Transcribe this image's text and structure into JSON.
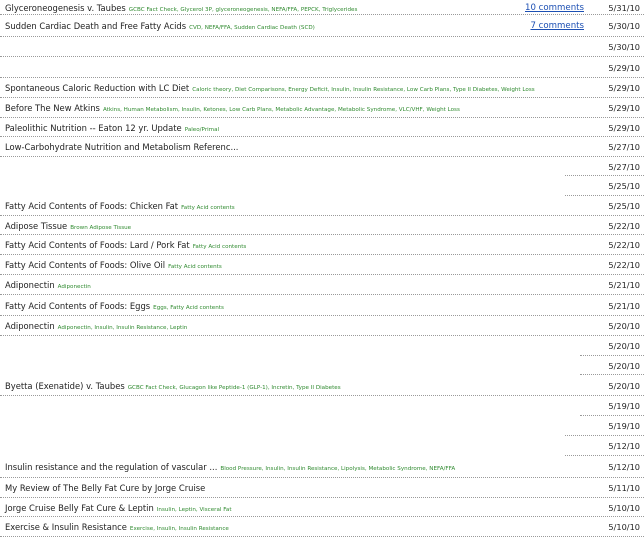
{
  "posts": [
    {
      "title": "Glyceroneogenesis v. Taubes",
      "tags": "GCBC Fact Check, Glycerol 3P, glyceroneogenesis, NEFA/FFA, PEPCK, Triglycerides",
      "comments": "10 comments",
      "date": "5/31/10"
    },
    {
      "title": "Sudden Cardiac Death and Free Fatty Acids",
      "tags": "CVD, NEFA/FFA, Sudden Cardiac Death (SCD)",
      "comments": "7 comments",
      "date": "5/30/10"
    },
    {
      "title": "",
      "tags": "",
      "comments": "",
      "date": "5/30/10"
    },
    {
      "title": "",
      "tags": "",
      "comments": "",
      "date": "5/29/10"
    },
    {
      "title": "Spontaneous Caloric Reduction with LC Diet",
      "tags": "Caloric theory, Diet Comparisons, Energy Deficit, Insulin, Insulin Resistance, Low Carb Plans, Type II Diabetes, Weight Loss",
      "comments": "",
      "date": "5/29/10"
    },
    {
      "title": "Before The New Atkins",
      "tags": "Atkins, Human Metabolism, Insulin, Ketones, Low Carb Plans, Metabolic Advantage, Metabolic Syndrome, VLC/VHF, Weight Loss",
      "comments": "",
      "date": "5/29/10"
    },
    {
      "title": "Paleolithic Nutrition -- Eaton 12 yr. Update",
      "tags": "Paleo/Primal",
      "comments": "",
      "date": "5/29/10"
    },
    {
      "title": "Low-Carbohydrate Nutrition and Metabolism Referenc...",
      "tags": "",
      "comments": "",
      "date": "5/27/10"
    },
    {
      "title": "",
      "tags": "",
      "comments": "",
      "date": "5/27/10"
    },
    {
      "title": "",
      "tags": "",
      "comments": "",
      "date": "5/25/10"
    },
    {
      "title": "Fatty Acid Contents of Foods: Chicken Fat",
      "tags": "Fatty Acid contents",
      "comments": "",
      "date": "5/25/10"
    },
    {
      "title": "Adipose Tissue",
      "tags": "Brown Adipose Tissue",
      "comments": "",
      "date": "5/22/10"
    },
    {
      "title": "Fatty Acid Contents of Foods: Lard / Pork Fat",
      "tags": "Fatty Acid contents",
      "comments": "",
      "date": "5/22/10"
    },
    {
      "title": "Fatty Acid Contents of Foods: Olive Oil",
      "tags": "Fatty Acid contents",
      "comments": "",
      "date": "5/22/10"
    },
    {
      "title": "Adiponectin",
      "tags": "Adiponectin",
      "comments": "",
      "date": "5/21/10"
    },
    {
      "title": "Fatty Acid Contents of Foods: Eggs",
      "tags": "Eggs, Fatty Acid contents",
      "comments": "",
      "date": "5/21/10"
    },
    {
      "title": "Adiponectin",
      "tags": "Adiponectin, Insulin, Insulin Resistance, Leptin",
      "comments": "",
      "date": "5/20/10"
    },
    {
      "title": "",
      "tags": "",
      "comments": "",
      "date": "5/20/10"
    },
    {
      "title": "",
      "tags": "",
      "comments": "",
      "date": "5/20/10"
    },
    {
      "title": "Byetta (Exenatide) v. Taubes",
      "tags": "GCBC Fact Check, Glucagon like Peptide-1 (GLP-1), Incretin, Type II Diabetes",
      "comments": "",
      "date": "5/20/10"
    },
    {
      "title": "",
      "tags": "",
      "comments": "",
      "date": "5/19/10"
    },
    {
      "title": "",
      "tags": "",
      "comments": "",
      "date": "5/19/10"
    },
    {
      "title": "",
      "tags": "",
      "comments": "",
      "date": "5/12/10"
    },
    {
      "title": "Insulin resistance and the regulation of vascular ...",
      "tags": "Blood Pressure, Insulin, Insulin Resistance, Lipolysis, Metabolic Syndrome, NEFA/FFA",
      "comments": "",
      "date": "5/12/10"
    },
    {
      "title": "My Review of The Belly Fat Cure by Jorge Cruise",
      "tags": "",
      "comments": "",
      "date": "5/11/10"
    },
    {
      "title": "Jorge Cruise Belly Fat Cure & Leptin",
      "tags": "Insulin, Leptin, Visceral Fat",
      "comments": "",
      "date": "5/10/10"
    },
    {
      "title": "Exercise & Insulin Resistance",
      "tags": "Exercise, Insulin, Insulin Resistance",
      "comments": "",
      "date": "5/10/10"
    }
  ]
}
